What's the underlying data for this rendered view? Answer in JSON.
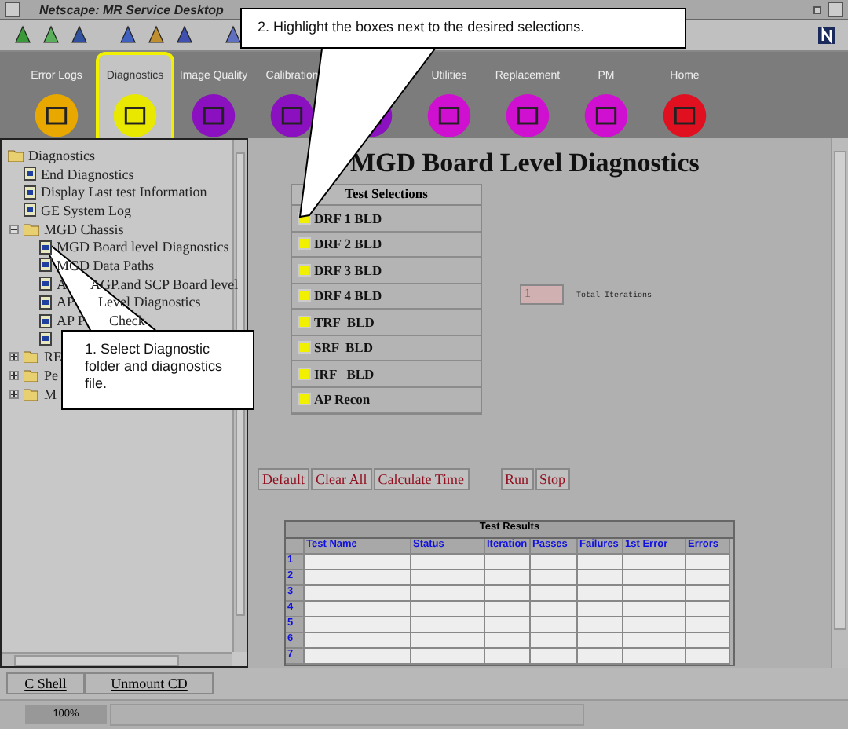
{
  "window": {
    "title": "Netscape: MR Service Desktop"
  },
  "nav_tabs": [
    {
      "kind": "tab",
      "label": "Error Logs",
      "color": "#e8a800",
      "selected": false
    },
    {
      "kind": "tab",
      "label": "Diagnostics",
      "color": "#e8e800",
      "selected": true
    },
    {
      "kind": "tab",
      "label": "Image Quality",
      "color": "#8a10c0",
      "selected": false
    },
    {
      "kind": "tab",
      "label": "Calibration",
      "color": "#8a10c0",
      "selected": false
    },
    {
      "kind": "covered",
      "color": "#8a10c0"
    },
    {
      "kind": "tab",
      "label": "Utilities",
      "color": "#d010d0",
      "selected": false
    },
    {
      "kind": "tab",
      "label": "Replacement",
      "color": "#d010d0",
      "selected": false
    },
    {
      "kind": "tab",
      "label": "PM",
      "color": "#d010d0",
      "selected": false
    },
    {
      "kind": "tab",
      "label": "Home",
      "color": "#e01020",
      "selected": false
    }
  ],
  "tree": [
    {
      "kind": "folder",
      "parts": [
        "Diagnostics"
      ],
      "expanded": true,
      "children": [
        {
          "kind": "file",
          "parts": [
            "End Diagnostics"
          ]
        },
        {
          "kind": "file",
          "parts": [
            "Display Last test Information"
          ]
        },
        {
          "kind": "file",
          "parts": [
            "GE System Log"
          ]
        },
        {
          "kind": "folder",
          "parts": [
            "MGD Chassis"
          ],
          "expanded": true,
          "children": [
            {
              "kind": "file",
              "parts": [
                "MGD Board level Diagnostics"
              ]
            },
            {
              "kind": "file",
              "parts": [
                "MGD Data Paths"
              ]
            },
            {
              "kind": "file",
              "parts": [
                "A",
                "AGP.and SCP Board level"
              ]
            },
            {
              "kind": "file",
              "parts": [
                "AP",
                "Level Diagnostics"
              ]
            },
            {
              "kind": "file",
              "parts": [
                "AP P",
                "Check"
              ]
            },
            {
              "kind": "file"
            }
          ]
        },
        {
          "kind": "folder",
          "parts": [
            "RE"
          ],
          "expanded": false
        },
        {
          "kind": "folder",
          "parts": [
            "Pe"
          ],
          "expanded": false
        },
        {
          "kind": "folder",
          "parts": [
            "M"
          ],
          "expanded": false
        }
      ]
    }
  ],
  "main": {
    "title": "MGD Board Level Diagnostics",
    "selections_title": "Test Selections",
    "selections": [
      {
        "label": "DRF 1 BLD",
        "highlighted": true
      },
      {
        "label": "DRF 2 BLD",
        "highlighted": true
      },
      {
        "label": "DRF 3 BLD",
        "highlighted": true
      },
      {
        "label": "DRF 4 BLD",
        "highlighted": true
      },
      {
        "label": "TRF  BLD",
        "highlighted": true
      },
      {
        "label": "SRF  BLD",
        "highlighted": true
      },
      {
        "label": "IRF   BLD",
        "highlighted": true
      },
      {
        "label": "AP Recon",
        "highlighted": true
      }
    ],
    "iterations": {
      "value": "1",
      "label": "Total Iterations"
    },
    "button_groups": [
      [
        "Default",
        "Clear All",
        "Calculate Time"
      ],
      [
        "Run",
        "Stop"
      ]
    ],
    "results": {
      "title": "Test Results",
      "columns": [
        "Test Name",
        "Status",
        "Iteration",
        "Passes",
        "Failures",
        "1st Error",
        "Errors"
      ],
      "rows": [
        "1",
        "2",
        "3",
        "4",
        "5",
        "6",
        "7"
      ]
    }
  },
  "bottom_buttons": [
    "C Shell",
    "Unmount CD"
  ],
  "status_bar": {
    "progress": "100%"
  },
  "callouts": [
    "1.  Select Diagnostic folder and diagnostics file.",
    "2.  Highlight the boxes next to the desired selections."
  ]
}
